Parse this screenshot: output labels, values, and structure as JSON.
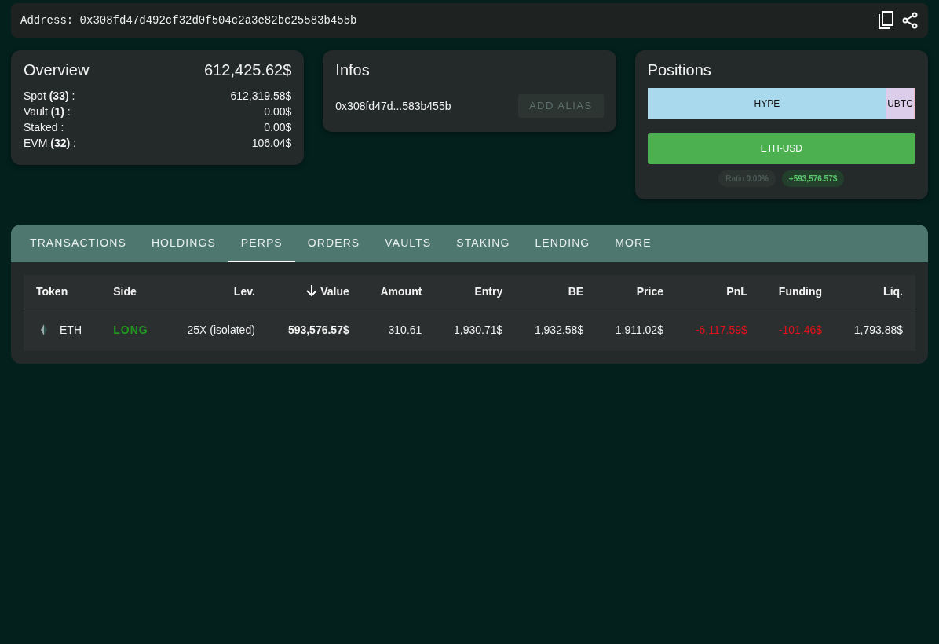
{
  "address": {
    "label": "Address:",
    "value": "0x308fd47d492cf32d0f504c2a3e82bc25583b455b"
  },
  "overview": {
    "title": "Overview",
    "total": "612,425.62$",
    "rows": [
      {
        "label": "Spot **(33)** :",
        "value": "612,319.58$"
      },
      {
        "label": "Vault **(1)** :",
        "value": "0.00$"
      },
      {
        "label": "Staked :",
        "value": "0.00$"
      },
      {
        "label": "EVM **(32)** :",
        "value": "106.04$"
      }
    ]
  },
  "infos": {
    "title": "Infos",
    "alias": "0x308fd47d...583b455b",
    "button": {
      "label": "ADD ALIAS",
      "disabled": true
    }
  },
  "positions": {
    "title": "Positions",
    "bars": [
      {
        "segments": [
          {
            "label": "HYPE",
            "color": "#a9d9ec"
          },
          {
            "label": "UBTC",
            "color": "#dccdea"
          },
          {
            "color": "#f2b6c6"
          }
        ]
      },
      {
        "segments": [
          {
            "label": "ETH-USD",
            "color": "#4caf50"
          }
        ]
      }
    ],
    "ratio": "Ratio **0.00%**",
    "pnl": "+593,576.57$"
  },
  "tabs": [
    {
      "label": "TRANSACTIONS",
      "selected": false
    },
    {
      "label": "HOLDINGS",
      "selected": false
    },
    {
      "label": "PERPS",
      "selected": true
    },
    {
      "label": "ORDERS",
      "selected": false
    },
    {
      "label": "VAULTS",
      "selected": false
    },
    {
      "label": "STAKING",
      "selected": false
    },
    {
      "label": "LENDING",
      "selected": false
    },
    {
      "label": "MORE",
      "selected": false
    }
  ],
  "table": {
    "columns": [
      {
        "label": "Token",
        "sorted": false
      },
      {
        "label": "Side",
        "sorted": false
      },
      {
        "label": "Lev.",
        "sorted": false
      },
      {
        "label": "Value",
        "sorted": true
      },
      {
        "label": "Amount",
        "sorted": false
      },
      {
        "label": "Entry",
        "sorted": false
      },
      {
        "label": "BE",
        "sorted": false
      },
      {
        "label": "Price",
        "sorted": false
      },
      {
        "label": "PnL",
        "sorted": false
      },
      {
        "label": "Funding",
        "sorted": false
      },
      {
        "label": "Liq.",
        "sorted": false
      }
    ],
    "rows": [
      {
        "cells": [
          {
            "text": "ETH",
            "kind": "token"
          },
          {
            "text": "LONG",
            "kind": "long"
          },
          {
            "text": "25X (isolated)",
            "kind": "plain"
          },
          {
            "text": "593,576.57$",
            "kind": "strong"
          },
          {
            "text": "310.61",
            "kind": "plain"
          },
          {
            "text": "1,930.71$",
            "kind": "plain"
          },
          {
            "text": "1,932.58$",
            "kind": "plain"
          },
          {
            "text": "1,911.02$",
            "kind": "plain"
          },
          {
            "text": "-6,117.59$",
            "kind": "negative"
          },
          {
            "text": "-101.46$",
            "kind": "negative"
          },
          {
            "text": "1,793.88$",
            "kind": "plain"
          }
        ]
      }
    ]
  }
}
